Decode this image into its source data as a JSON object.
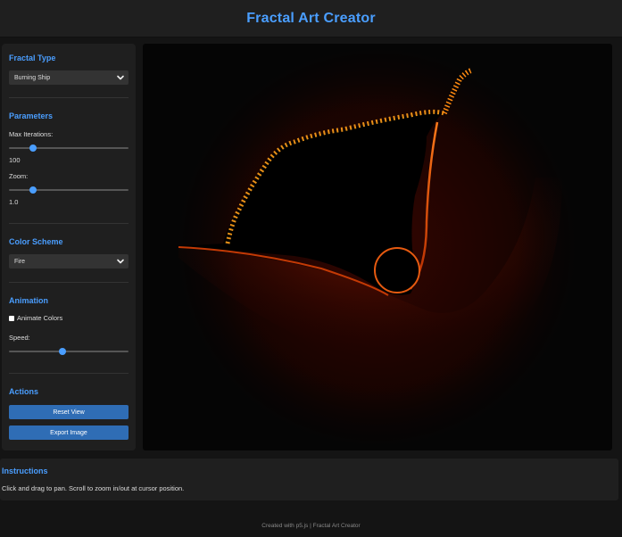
{
  "header": {
    "title": "Fractal Art Creator"
  },
  "sidebar": {
    "fractal_type": {
      "title": "Fractal Type",
      "selected": "Burning Ship"
    },
    "parameters": {
      "title": "Parameters",
      "max_iterations": {
        "label": "Max Iterations:",
        "value": "100",
        "fraction": 0.2
      },
      "zoom": {
        "label": "Zoom:",
        "value": "1.0",
        "fraction": 0.2
      }
    },
    "color_scheme": {
      "title": "Color Scheme",
      "selected": "Fire"
    },
    "animation": {
      "title": "Animation",
      "animate_label": "Animate Colors",
      "animate_checked": false,
      "speed_label": "Speed:",
      "speed_fraction": 0.45
    },
    "actions": {
      "title": "Actions",
      "reset_label": "Reset View",
      "export_label": "Export Image"
    }
  },
  "instructions": {
    "title": "Instructions",
    "text": "Click and drag to pan. Scroll to zoom in/out at cursor position."
  },
  "footer": {
    "text": "Created with p5.js | Fractal Art Creator"
  },
  "colors": {
    "accent": "#4a9eff",
    "button": "#2f6db5",
    "panel": "#1f1f1f",
    "background": "#141414"
  },
  "icons": {
    "select_arrow": "chevron-down-icon"
  }
}
